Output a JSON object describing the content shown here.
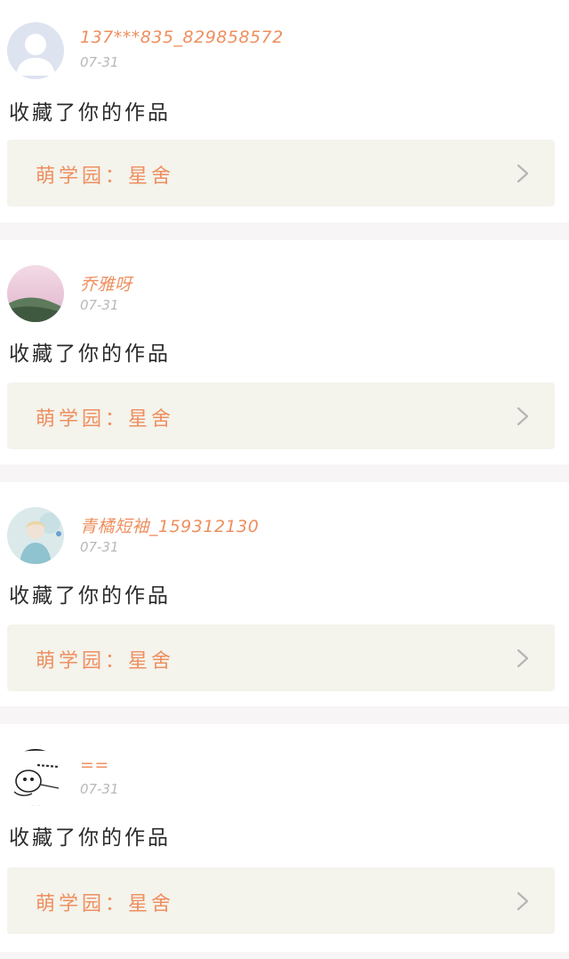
{
  "feed": {
    "items": [
      {
        "avatar": "default-user-avatar",
        "username": "137***835_829858572",
        "date": "07-31",
        "action": "收藏了你的作品",
        "work_label": "萌学园：星舍",
        "chevron": "chevron-right-icon"
      },
      {
        "avatar": "landscape-photo-avatar",
        "username": "乔雅呀",
        "date": "07-31",
        "action": "收藏了你的作品",
        "work_label": "萌学园：星舍",
        "chevron": "chevron-right-icon"
      },
      {
        "avatar": "illustrated-girl-avatar",
        "username": "青橘短袖_159312130",
        "date": "07-31",
        "action": "收藏了你的作品",
        "work_label": "萌学园：星舍",
        "chevron": "chevron-right-icon"
      },
      {
        "avatar": "sketch-character-avatar",
        "username": "==",
        "date": "07-31",
        "action": "收藏了你的作品",
        "work_label": "萌学园：星舍",
        "chevron": "chevron-right-icon"
      }
    ]
  },
  "colors": {
    "accent": "#ee8f5f",
    "date": "#b8b8b8",
    "text": "#2a2a2a",
    "link_bg": "#f4f3ec",
    "separator": "#f7f5f5"
  }
}
